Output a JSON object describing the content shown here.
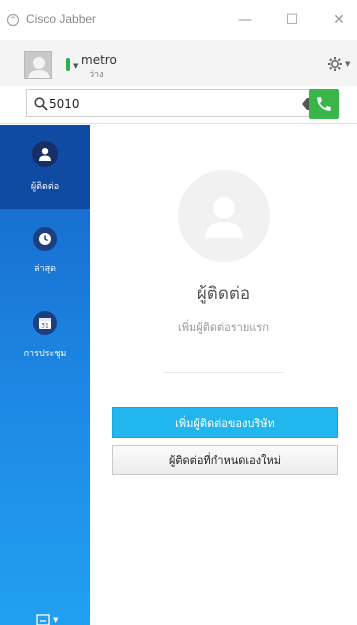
{
  "window": {
    "title": "Cisco Jabber",
    "minimize": "—",
    "maximize": "☐",
    "close": "✕"
  },
  "user": {
    "name": "metro",
    "status": "ว่าง",
    "status_color": "#2bb24c"
  },
  "search": {
    "value": "5010",
    "placeholder": ""
  },
  "sidebar": {
    "items": [
      {
        "label": "ผู้ติดต่อ",
        "icon": "person-icon",
        "active": true
      },
      {
        "label": "ล่าสุด",
        "icon": "clock-icon",
        "active": false
      },
      {
        "label": "การประชุม",
        "icon": "calendar-icon",
        "active": false,
        "calendar_day": "31"
      }
    ]
  },
  "empty_state": {
    "title": "ผู้ติดต่อ",
    "subtitle": "เพิ่มผู้ติดต่อรายแรก",
    "primary_button": "เพิ่มผู้ติดต่อของบริษัท",
    "secondary_button": "ผู้ติดต่อที่กำหนดเองใหม่"
  },
  "colors": {
    "accent": "#22b6ee",
    "sidebar": "#1565c8",
    "call_green": "#3ab54a"
  }
}
